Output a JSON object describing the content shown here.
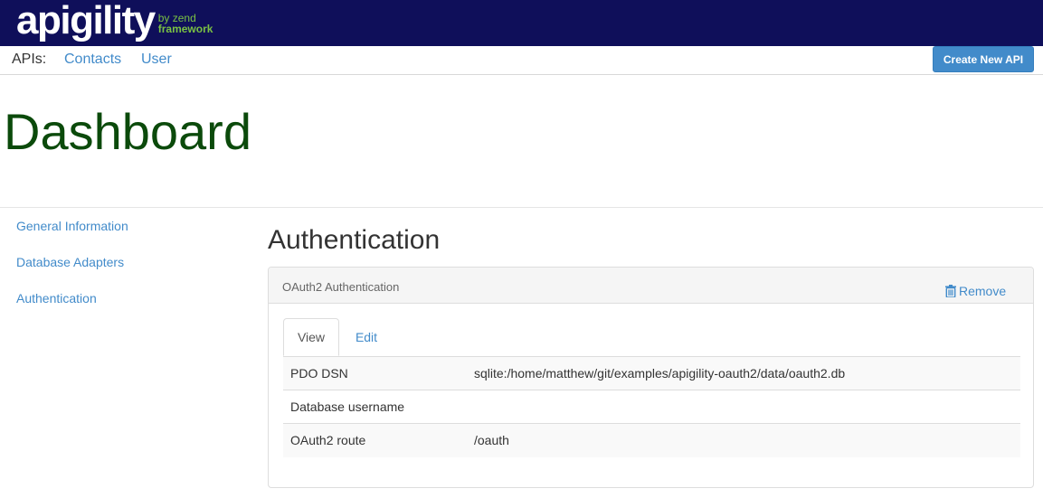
{
  "brand": {
    "name": "apigility",
    "by": "by zend",
    "framework": "framework"
  },
  "apibar": {
    "label": "APIs:",
    "apis": [
      "Contacts",
      "User"
    ],
    "create_button": "Create New API"
  },
  "page_title": "Dashboard",
  "sidebar": {
    "items": [
      {
        "label": "General Information"
      },
      {
        "label": "Database Adapters"
      },
      {
        "label": "Authentication"
      }
    ]
  },
  "main": {
    "section_title": "Authentication",
    "panel": {
      "title": "OAuth2 Authentication",
      "remove_label": "Remove",
      "tabs": [
        {
          "label": "View",
          "active": true
        },
        {
          "label": "Edit",
          "active": false
        }
      ],
      "rows": [
        {
          "key": "PDO DSN",
          "value": "sqlite:/home/matthew/git/examples/apigility-oauth2/data/oauth2.db"
        },
        {
          "key": "Database username",
          "value": ""
        },
        {
          "key": "OAuth2 route",
          "value": "/oauth"
        }
      ]
    }
  },
  "colors": {
    "topbar": "#0f0f5a",
    "brand_accent": "#7ac143",
    "link": "#428bca",
    "title": "#0b4a0b"
  },
  "icons": {
    "remove": "trash-icon"
  }
}
